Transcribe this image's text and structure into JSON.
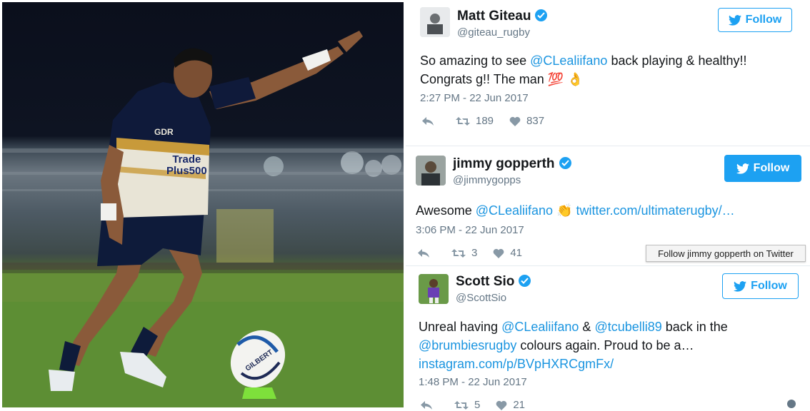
{
  "tweets": [
    {
      "name": "Matt Giteau",
      "handle": "@giteau_rugby",
      "follow_label": "Follow",
      "text_prefix": "So amazing to see ",
      "mention": "@CLealiifano",
      "text_suffix": " back playing & healthy!!",
      "line2": "Congrats g!! The man ",
      "emoji1": "💯",
      "emoji2": "👌",
      "time": "2:27 PM - 22 Jun 2017",
      "retweets": "189",
      "likes": "837"
    },
    {
      "name": "jimmy gopperth",
      "handle": "@jimmygopps",
      "follow_label": "Follow",
      "text_prefix": "Awesome ",
      "mention": "@CLealiifano",
      "emoji1": "👏",
      "link": "twitter.com/ultimaterugby/…",
      "time": "3:06 PM - 22 Jun 2017",
      "retweets": "3",
      "likes": "41"
    },
    {
      "name": "Scott Sio",
      "handle": "@ScottSio",
      "follow_label": "Follow",
      "text_prefix": "Unreal having ",
      "mention": "@CLealiifano",
      "amp": " & ",
      "mention2": "@tcubelli89",
      "text_suffix": " back in the",
      "mention3": "@brumbiesrugby",
      "line2_suffix": " colours again. Proud to be a…",
      "link": "instagram.com/p/BVpHXRCgmFx/",
      "time": "1:48 PM - 22 Jun 2017",
      "retweets": "5",
      "likes": "21"
    }
  ],
  "tooltip": "Follow jimmy gopperth on Twitter",
  "photo": {
    "jersey_sponsor_line1": "Trade",
    "jersey_sponsor_line2": "Plus500",
    "chest_logo": "GDR",
    "ball_text": "GILBERT"
  },
  "colors": {
    "twitter_blue": "#1da1f2",
    "link_blue": "#1b95e0",
    "grey_text": "#657786"
  }
}
